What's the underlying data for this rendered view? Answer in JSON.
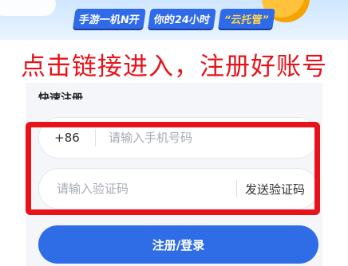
{
  "banner": {
    "slogan_part1": "手游一机N开",
    "slogan_part2": "你的24小时",
    "slogan_part3": "“云托管”"
  },
  "headline": "点击链接进入，注册好账号",
  "form": {
    "title": "快速注册",
    "country_code": "+86",
    "phone_placeholder": "请输入手机号码",
    "code_placeholder": "请输入验证码",
    "send_code_label": "发送验证码",
    "submit_label": "注册/登录"
  },
  "colors": {
    "headline_red": "#e7131a",
    "highlight_box": "#e8121a",
    "primary_blue": "#2e6de6"
  }
}
